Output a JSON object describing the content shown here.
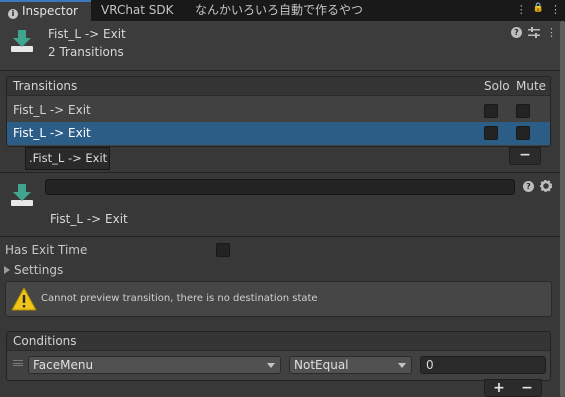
{
  "tabs": [
    {
      "label": "Inspector",
      "active": true
    },
    {
      "label": "VRChat SDK",
      "active": false
    },
    {
      "label": "なんかいろいろ自動で作るやつ",
      "active": false
    }
  ],
  "tabbar_tools": [
    "⋮",
    "🔒",
    "⋮"
  ],
  "header": {
    "title": "Fist_L -> Exit",
    "subtitle": "2 Transitions"
  },
  "transitions": {
    "heading": "Transitions",
    "col_solo": "Solo",
    "col_mute": "Mute",
    "rows": [
      {
        "label": "Fist_L -> Exit",
        "selected": false
      },
      {
        "label": "Fist_L -> Exit",
        "selected": true
      }
    ],
    "tooltip": ".Fist_L -> Exit",
    "remove_label": "−"
  },
  "detail": {
    "name_value": "",
    "title": "Fist_L -> Exit"
  },
  "has_exit_time_label": "Has Exit Time",
  "settings_label": "Settings",
  "warning_text": "Cannot preview transition, there is no destination state",
  "conditions": {
    "heading": "Conditions",
    "parameter": "FaceMenu",
    "mode": "NotEqual",
    "value": "0",
    "add_label": "+",
    "remove_label": "−"
  },
  "colors": {
    "accent": "#3a79bb",
    "selection": "#2c5d87",
    "icon_green": "#3fa58e",
    "warning": "#f0c419"
  }
}
